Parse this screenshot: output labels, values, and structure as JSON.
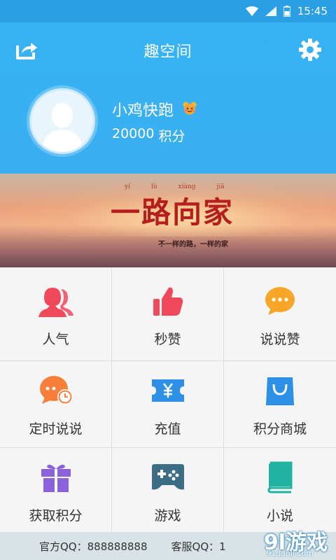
{
  "status_bar": {
    "time": "15:45",
    "icons": [
      "wifi-icon",
      "signal-icon",
      "battery-icon"
    ]
  },
  "header": {
    "title": "趣空间",
    "left_icon": "share-icon",
    "right_icon": "gear-icon"
  },
  "profile": {
    "name": "小鸡快跑",
    "badge_icon": "crown-emoji-icon",
    "points_value": "20000",
    "points_unit": "积分"
  },
  "banner": {
    "pinyin": [
      "yí",
      "lù",
      "xiàng",
      "jiā"
    ],
    "title": "一路向家",
    "subtitle": "不一样的路，一样的家"
  },
  "grid": [
    {
      "label": "人气",
      "icon": "users-icon",
      "color": "#f0495b"
    },
    {
      "label": "秒赞",
      "icon": "thumbs-up-icon",
      "color": "#f0495b"
    },
    {
      "label": "说说赞",
      "icon": "chat-bubble-icon",
      "color": "#f7a627"
    },
    {
      "label": "定时说说",
      "icon": "timed-chat-icon",
      "color": "#f77f3a"
    },
    {
      "label": "充值",
      "icon": "yen-ticket-icon",
      "color": "#2d8fe6"
    },
    {
      "label": "积分商城",
      "icon": "shopping-bag-icon",
      "color": "#2d8fe6"
    },
    {
      "label": "获取积分",
      "icon": "gift-icon",
      "color": "#8b62d9"
    },
    {
      "label": "游戏",
      "icon": "gamepad-icon",
      "color": "#3b6d85"
    },
    {
      "label": "小说",
      "icon": "book-icon",
      "color": "#21b3a2"
    }
  ],
  "footer": {
    "official_qq": "官方QQ：888888888",
    "service_qq": "客服QQ：1"
  },
  "watermark": {
    "main": "9l游戏",
    "sub": "91danji.com"
  },
  "colors": {
    "header_blue": "#36b3f3",
    "status_blue": "#2b9fe6"
  }
}
